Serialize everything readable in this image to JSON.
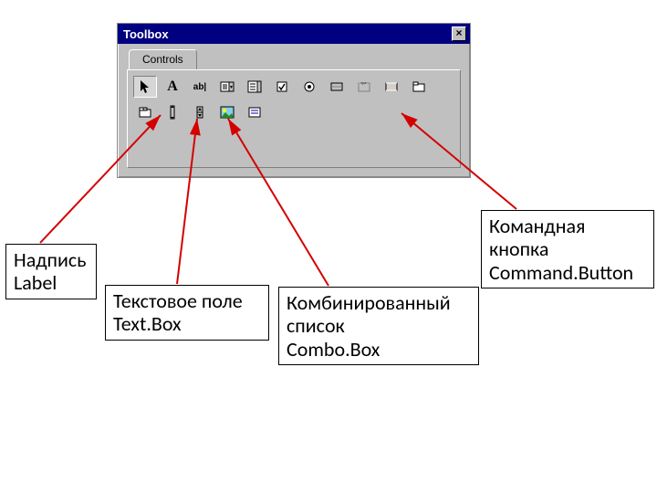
{
  "toolbox": {
    "title": "Toolbox",
    "tab_label": "Controls",
    "close_glyph": "×",
    "tools_row1": [
      "pointer",
      "label",
      "textbox",
      "combobox",
      "listbox",
      "checkbox",
      "option",
      "toggle",
      "frame",
      "command",
      "tabstrip"
    ],
    "tools_row2": [
      "multipage",
      "scrollbar",
      "spin",
      "image",
      "extra"
    ]
  },
  "annotations": {
    "label": "Надпись\nLabel",
    "textbox": "Текстовое поле\nText.Box",
    "combobox": "Комбинированный\nсписок\nCombo.Box",
    "command": "Командная\nкнопка\nCommand.Button"
  }
}
